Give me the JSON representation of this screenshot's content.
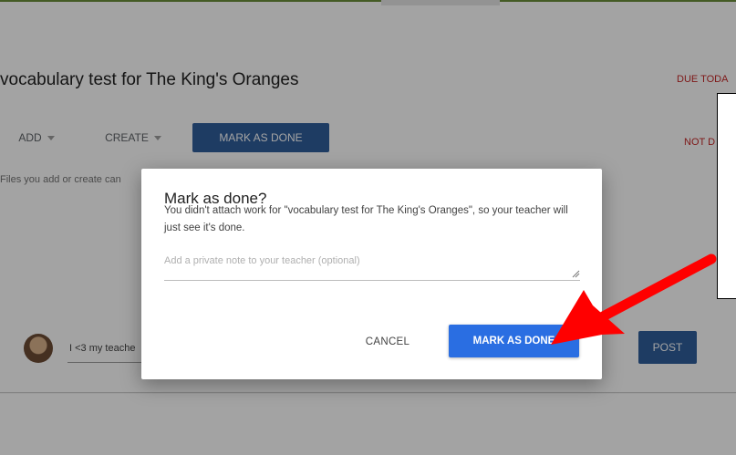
{
  "assignment": {
    "title": "vocabulary test for The King's Oranges",
    "due_label": "DUE TODA",
    "status_label": "NOT D",
    "add_label": "ADD",
    "create_label": "CREATE",
    "mark_done_label": "MARK AS DONE",
    "files_hint": "Files you add or create can"
  },
  "comment": {
    "value": "I <3 my teache",
    "post_label": "POST"
  },
  "dialog": {
    "title": "Mark as done?",
    "body": "You didn't attach work for \"vocabulary test for The King's Oranges\", so your teacher will just see it's done.",
    "note_placeholder": "Add a private note to your teacher (optional)",
    "cancel_label": "CANCEL",
    "confirm_label": "MARK AS DONE"
  },
  "colors": {
    "primary_button": "#2a6ee2",
    "dark_button": "#2f5e9c",
    "due_text": "#c62828",
    "annotation_arrow": "#ff0000"
  },
  "icons": {
    "add_caret": "chevron-down-icon",
    "create_caret": "chevron-down-icon",
    "annotation": "red-arrow-icon"
  }
}
